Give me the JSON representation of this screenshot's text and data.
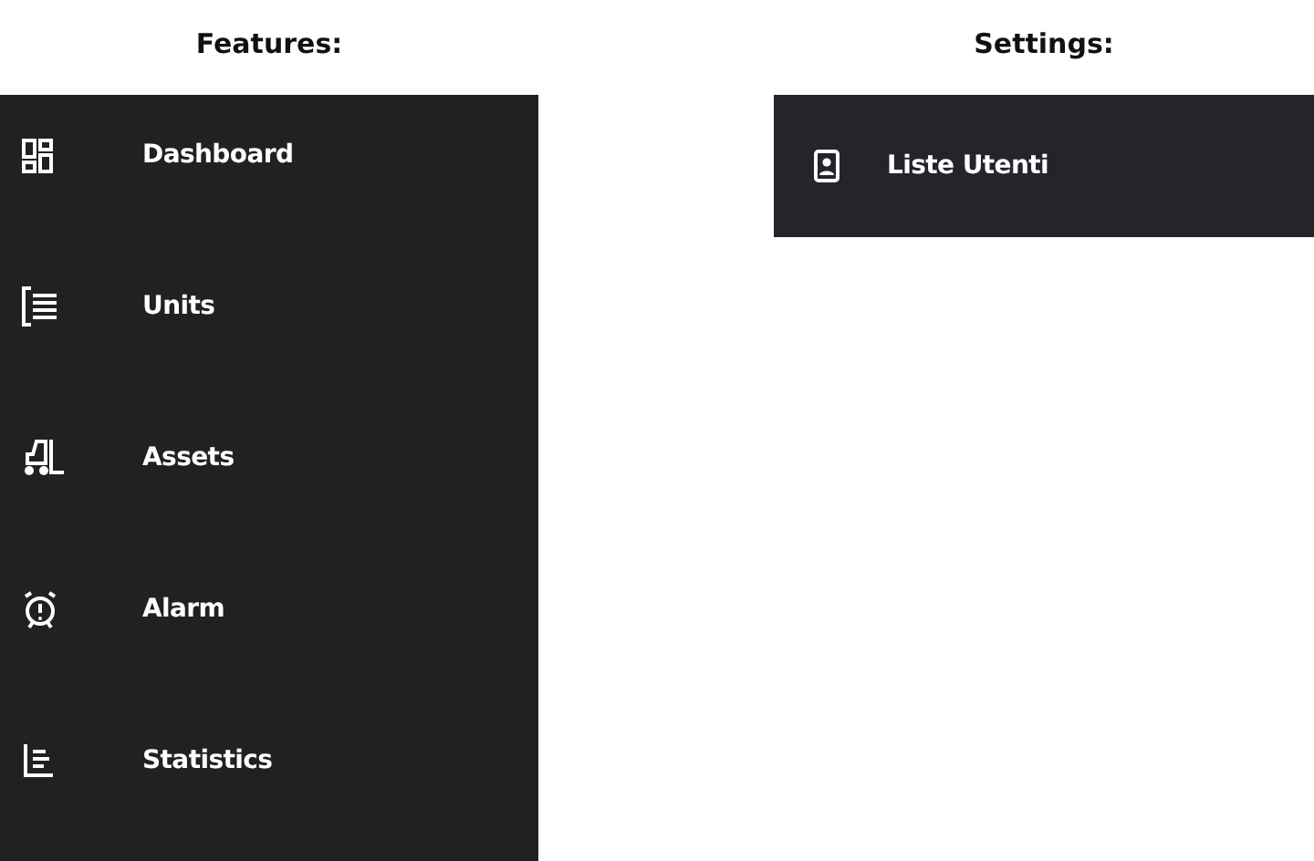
{
  "features": {
    "heading": "Features:",
    "items": [
      {
        "kind": "grid",
        "label": "Dashboard"
      },
      {
        "kind": "list",
        "label": "Units"
      },
      {
        "kind": "forklift",
        "label": "Assets"
      },
      {
        "kind": "alarm",
        "label": "Alarm"
      },
      {
        "kind": "stats",
        "label": "Statistics"
      }
    ]
  },
  "settings": {
    "heading": "Settings:",
    "items": [
      {
        "kind": "badge",
        "label": "Liste Utenti"
      }
    ]
  }
}
